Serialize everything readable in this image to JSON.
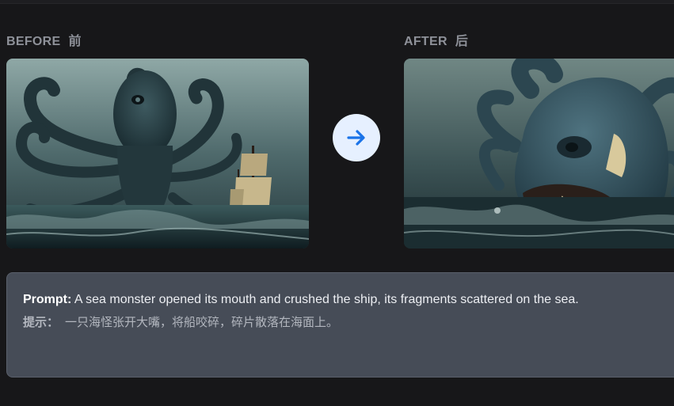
{
  "before": {
    "label_en": "BEFORE",
    "label_cn": "前",
    "image_icon": "image-octopus-ship"
  },
  "after": {
    "label_en": "AFTER",
    "label_cn": "后",
    "image_icon": "image-monster-crushing-ship"
  },
  "transform_button": {
    "icon": "arrow-right-icon",
    "accent": "#1a73e8",
    "background": "#e6f0ff"
  },
  "prompt": {
    "en_label": "Prompt:",
    "en_text": "A sea monster opened its mouth and crushed the ship, its fragments scattered on the sea.",
    "cn_label": "提示：",
    "cn_text": "一只海怪张开大嘴，将船咬碎，碎片散落在海面上。"
  },
  "colors": {
    "background": "#171719",
    "panel": "#464c57",
    "label": "#8e9199"
  }
}
